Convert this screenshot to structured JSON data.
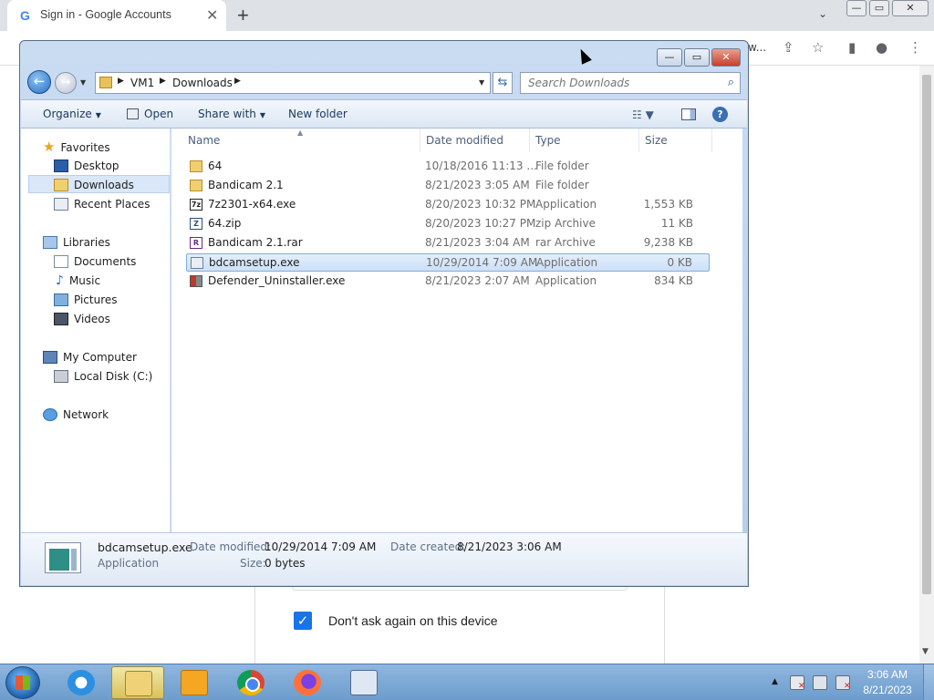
{
  "browser": {
    "tab_title": "Sign in - Google Accounts",
    "tab_icon_letter": "G",
    "tab_close": "✕",
    "new_tab": "+",
    "tab_search": "⌄",
    "toolbar_partial_text": "w...",
    "checkbox_label": "Don't ask again on this device"
  },
  "explorer": {
    "title_buttons": {
      "minimize": "—",
      "maximize": "▭",
      "close": "✕"
    },
    "address": {
      "crumbs": [
        "VM1",
        "Downloads"
      ]
    },
    "search": {
      "placeholder": "Search Downloads"
    },
    "commands": {
      "organize": "Organize",
      "open": "Open",
      "share_with": "Share with",
      "new_folder": "New folder"
    },
    "nav_pane": {
      "favorites": "Favorites",
      "desktop": "Desktop",
      "downloads": "Downloads",
      "recent_places": "Recent Places",
      "libraries": "Libraries",
      "documents": "Documents",
      "music": "Music",
      "pictures": "Pictures",
      "videos": "Videos",
      "my_computer": "My Computer",
      "local_disk": "Local Disk (C:)",
      "network": "Network"
    },
    "columns": {
      "name": "Name",
      "date": "Date modified",
      "type": "Type",
      "size": "Size"
    },
    "files": [
      {
        "name": "64",
        "date": "10/18/2016 11:13 ...",
        "type": "File folder",
        "size": "",
        "icon": "folder"
      },
      {
        "name": "Bandicam 2.1",
        "date": "8/21/2023 3:05 AM",
        "type": "File folder",
        "size": "",
        "icon": "folder"
      },
      {
        "name": "7z2301-x64.exe",
        "date": "8/20/2023 10:32 PM",
        "type": "Application",
        "size": "1,553 KB",
        "icon": "7z"
      },
      {
        "name": "64.zip",
        "date": "8/20/2023 10:27 PM",
        "type": "zip Archive",
        "size": "11 KB",
        "icon": "zip"
      },
      {
        "name": "Bandicam 2.1.rar",
        "date": "8/21/2023 3:04 AM",
        "type": "rar Archive",
        "size": "9,238 KB",
        "icon": "rar"
      },
      {
        "name": "bdcamsetup.exe",
        "date": "10/29/2014 7:09 AM",
        "type": "Application",
        "size": "0 KB",
        "icon": "app"
      },
      {
        "name": "Defender_Uninstaller.exe",
        "date": "8/21/2023 2:07 AM",
        "type": "Application",
        "size": "834 KB",
        "icon": "defender"
      }
    ],
    "details": {
      "name": "bdcamsetup.exe",
      "type": "Application",
      "date_modified_label": "Date modified:",
      "date_modified": "10/29/2014 7:09 AM",
      "date_created_label": "Date created:",
      "date_created": "8/21/2023 3:06 AM",
      "size_label": "Size:",
      "size": "0 bytes"
    }
  },
  "taskbar": {
    "time": "3:06 AM",
    "date": "8/21/2023"
  }
}
